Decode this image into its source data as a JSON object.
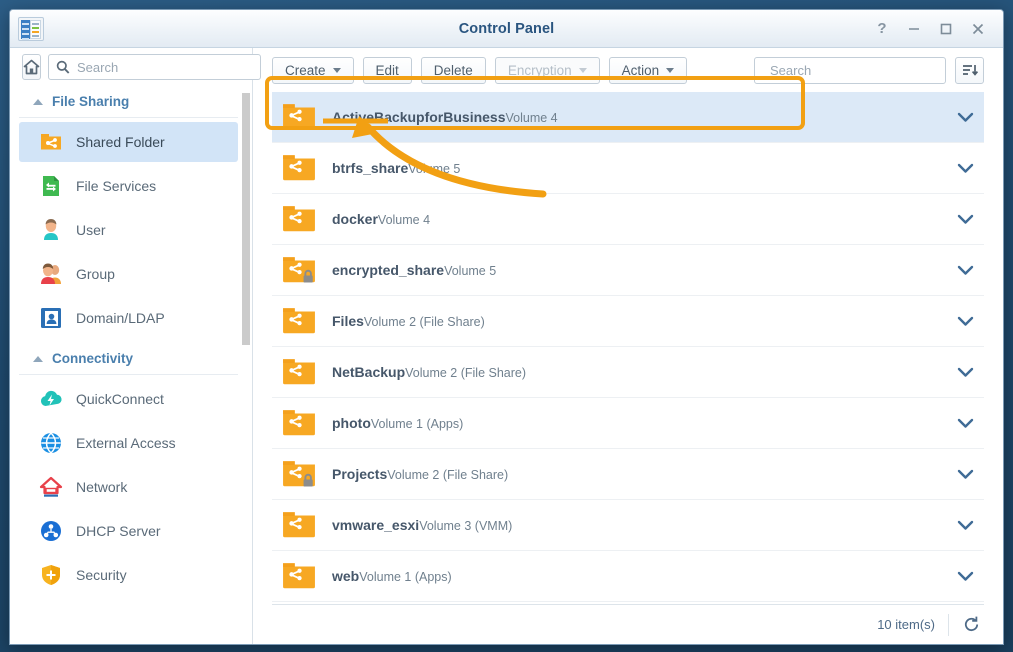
{
  "window": {
    "title": "Control Panel",
    "app_icon": "control-panel-icon",
    "buttons": {
      "help": "?",
      "minimize": "minimize-icon",
      "maximize": "maximize-icon",
      "close": "close-icon"
    }
  },
  "sidebar": {
    "home_icon": "home-icon",
    "search": {
      "placeholder": "Search",
      "value": ""
    },
    "groups": [
      {
        "title": "File Sharing",
        "collapse_icon": "chevron-up-icon",
        "items": [
          {
            "label": "Shared Folder",
            "icon": "shared-folder-icon",
            "active": true
          },
          {
            "label": "File Services",
            "icon": "file-services-icon",
            "active": false
          },
          {
            "label": "User",
            "icon": "user-icon",
            "active": false
          },
          {
            "label": "Group",
            "icon": "group-icon",
            "active": false
          },
          {
            "label": "Domain/LDAP",
            "icon": "domain-ldap-icon",
            "active": false
          }
        ]
      },
      {
        "title": "Connectivity",
        "collapse_icon": "chevron-up-icon",
        "items": [
          {
            "label": "QuickConnect",
            "icon": "quickconnect-icon",
            "active": false
          },
          {
            "label": "External Access",
            "icon": "external-access-icon",
            "active": false
          },
          {
            "label": "Network",
            "icon": "network-icon",
            "active": false
          },
          {
            "label": "DHCP Server",
            "icon": "dhcp-server-icon",
            "active": false
          },
          {
            "label": "Security",
            "icon": "security-icon",
            "active": false
          }
        ]
      }
    ]
  },
  "toolbar": {
    "create_label": "Create",
    "edit_label": "Edit",
    "delete_label": "Delete",
    "encryption_label": "Encryption",
    "encryption_disabled": true,
    "action_label": "Action",
    "search": {
      "placeholder": "Search",
      "value": "",
      "icon": "filter-icon"
    },
    "sort_icon": "sort-descending-icon"
  },
  "list": {
    "rows": [
      {
        "name": "ActiveBackupforBusiness",
        "volume": "Volume 4",
        "icon": "shared-folder-icon",
        "locked": false,
        "selected": true
      },
      {
        "name": "btrfs_share",
        "volume": "Volume 5",
        "icon": "shared-folder-icon",
        "locked": false,
        "selected": false
      },
      {
        "name": "docker",
        "volume": "Volume 4",
        "icon": "shared-folder-icon",
        "locked": false,
        "selected": false
      },
      {
        "name": "encrypted_share",
        "volume": "Volume 5",
        "icon": "shared-folder-encrypted-icon",
        "locked": true,
        "selected": false
      },
      {
        "name": "Files",
        "volume": "Volume 2 (File Share)",
        "icon": "shared-folder-icon",
        "locked": false,
        "selected": false
      },
      {
        "name": "NetBackup",
        "volume": "Volume 2 (File Share)",
        "icon": "shared-folder-icon",
        "locked": false,
        "selected": false
      },
      {
        "name": "photo",
        "volume": "Volume 1 (Apps)",
        "icon": "shared-folder-icon",
        "locked": false,
        "selected": false
      },
      {
        "name": "Projects",
        "volume": "Volume 2 (File Share)",
        "icon": "shared-folder-encrypted-icon",
        "locked": true,
        "selected": false
      },
      {
        "name": "vmware_esxi",
        "volume": "Volume 3 (VMM)",
        "icon": "shared-folder-icon",
        "locked": false,
        "selected": false
      },
      {
        "name": "web",
        "volume": "Volume 1 (Apps)",
        "icon": "shared-folder-icon",
        "locked": false,
        "selected": false
      }
    ],
    "row_expand_icon": "chevron-down-icon"
  },
  "footer": {
    "item_count": "10 item(s)",
    "refresh_icon": "refresh-icon"
  },
  "annotation": {
    "color": "#f2a013",
    "highlight_target": "ActiveBackupforBusiness",
    "arrow_target": "Volume 4"
  }
}
